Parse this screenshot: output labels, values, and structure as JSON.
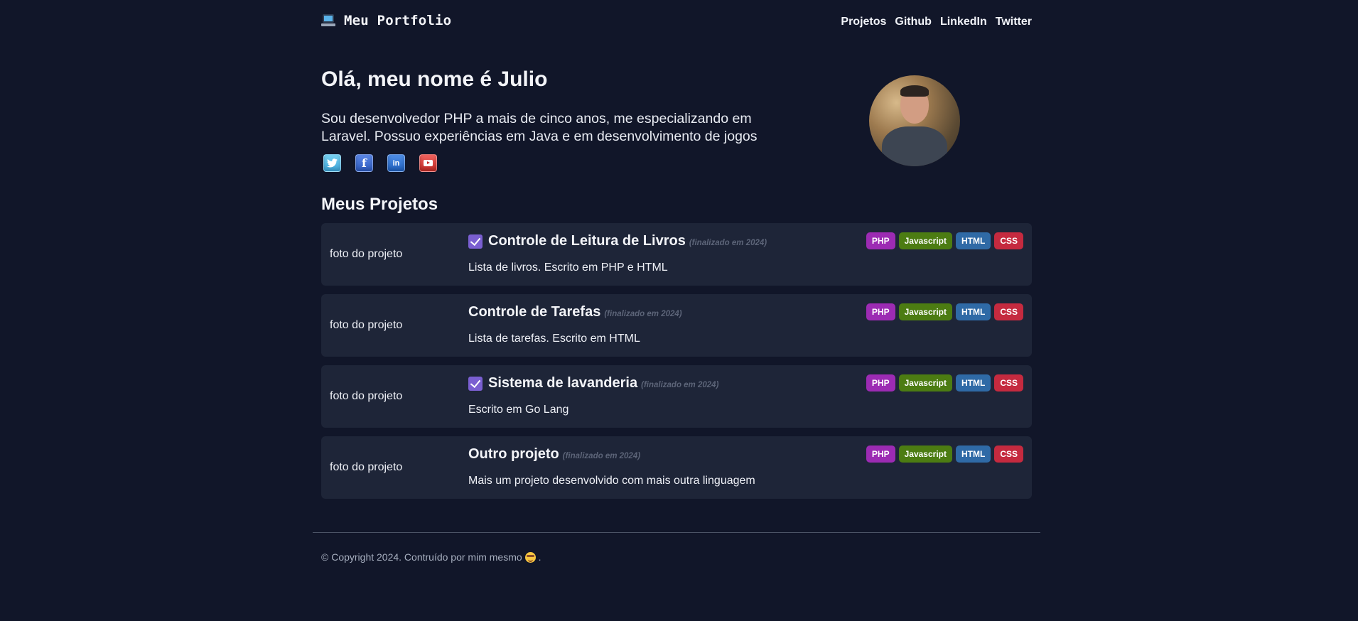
{
  "header": {
    "brand": "Meu Portfolio",
    "brand_icon": "laptop-icon",
    "nav": [
      "Projetos",
      "Github",
      "LinkedIn",
      "Twitter"
    ]
  },
  "hero": {
    "title": "Olá, meu nome é Julio",
    "description": "Sou desenvolvedor PHP a mais de cinco anos, me especializando em Laravel. Possuo experiências em Java e em desenvolvimento de jogos",
    "socials": [
      "twitter-icon",
      "facebook-icon",
      "linkedin-icon",
      "youtube-icon"
    ]
  },
  "projects": {
    "title": "Meus Projetos",
    "tag_colors": {
      "PHP": "#9c2bb3",
      "Javascript": "#4c7c12",
      "HTML": "#2f6aa6",
      "CSS": "#c52a3f"
    },
    "items": [
      {
        "photo": "foto do projeto",
        "checked": true,
        "title": "Controle de Leitura de Livros",
        "status": "(finalizado em 2024)",
        "description": "Lista de livros. Escrito em PHP e HTML",
        "tags": [
          "PHP",
          "Javascript",
          "HTML",
          "CSS"
        ]
      },
      {
        "photo": "foto do projeto",
        "checked": false,
        "title": "Controle de Tarefas",
        "status": "(finalizado em 2024)",
        "description": "Lista de tarefas. Escrito em HTML",
        "tags": [
          "PHP",
          "Javascript",
          "HTML",
          "CSS"
        ]
      },
      {
        "photo": "foto do projeto",
        "checked": true,
        "title": "Sistema de lavanderia",
        "status": "(finalizado em 2024)",
        "description": "Escrito em Go Lang",
        "tags": [
          "PHP",
          "Javascript",
          "HTML",
          "CSS"
        ]
      },
      {
        "photo": "foto do projeto",
        "checked": false,
        "title": "Outro projeto",
        "status": "(finalizado em 2024)",
        "description": "Mais um projeto desenvolvido com mais outra linguagem",
        "tags": [
          "PHP",
          "Javascript",
          "HTML",
          "CSS"
        ]
      }
    ]
  },
  "footer": {
    "text": "© Copyright 2024. Contruído por mim mesmo",
    "emoji": "smiling-face-icon",
    "suffix": "."
  }
}
